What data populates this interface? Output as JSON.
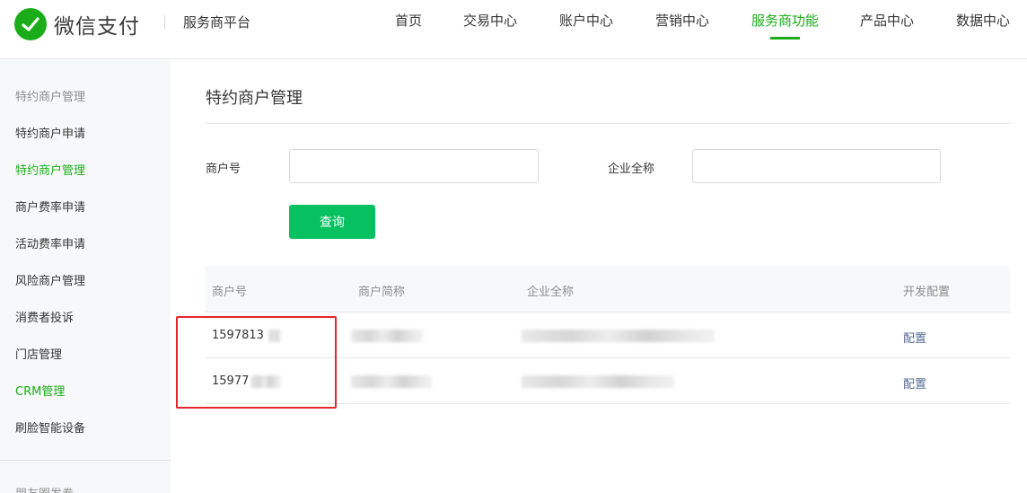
{
  "header": {
    "brand": "微信支付",
    "platform": "服务商平台",
    "nav": [
      "首页",
      "交易中心",
      "账户中心",
      "营销中心",
      "服务商功能",
      "产品中心",
      "数据中心"
    ],
    "active_nav": "服务商功能"
  },
  "sidebar": {
    "group_title": "特约商户管理",
    "items": [
      "特约商户申请",
      "特约商户管理",
      "商户费率申请",
      "活动费率申请",
      "风险商户管理",
      "消费者投诉",
      "门店管理",
      "CRM管理",
      "刷脸智能设备"
    ],
    "active_items": [
      "特约商户管理",
      "CRM管理"
    ],
    "next_group_title": "朋友圈发券"
  },
  "main": {
    "title": "特约商户管理",
    "filters": {
      "merchant_id_label": "商户号",
      "merchant_id_value": "",
      "company_name_label": "企业全称",
      "company_name_value": ""
    },
    "query_button": "查询",
    "table": {
      "headers": [
        "商户号",
        "商户简称",
        "企业全称",
        "开发配置"
      ],
      "rows": [
        {
          "merchant_id": "1597813",
          "action": "配置"
        },
        {
          "merchant_id": "15977",
          "action": "配置"
        }
      ]
    }
  },
  "colors": {
    "brand_green": "#1aad19",
    "button_green": "#07c160",
    "link_blue": "#576b95",
    "highlight_red": "#e5262d"
  }
}
